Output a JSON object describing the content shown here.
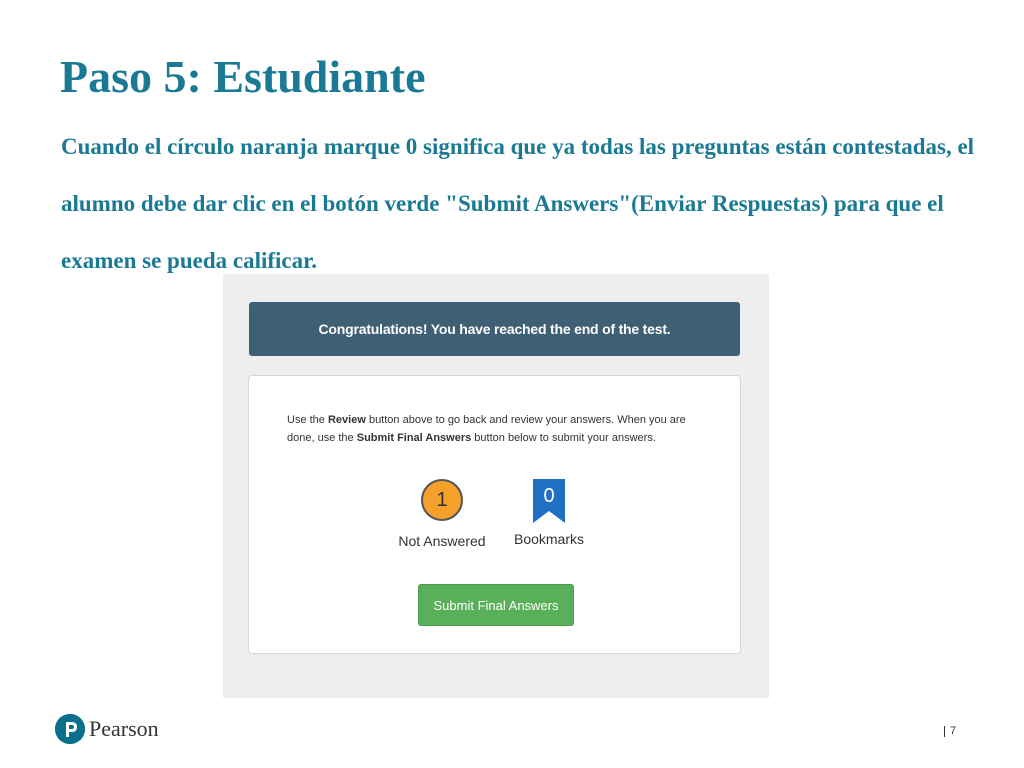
{
  "slide": {
    "title": "Paso 5: Estudiante",
    "body": "Cuando el círculo naranja marque 0 significa que ya todas las preguntas están contestadas, el alumno debe dar clic en el botón verde \"Submit Answers\"(Enviar Respuestas) para que el examen se pueda calificar.",
    "page_number": "7"
  },
  "brand": {
    "name": "Pearson",
    "color": "#0a6f8a"
  },
  "test_screen": {
    "banner": "Congratulations! You have reached the end of the test.",
    "instructions": {
      "part1": "Use the ",
      "review": "Review",
      "part2": " button above to go back and review your answers. When you are done, use the ",
      "submit_final": "Submit Final Answers",
      "part3": " button below to submit your answers."
    },
    "not_answered": {
      "count": "1",
      "label": "Not Answered",
      "color": "#f6a02c"
    },
    "bookmarks": {
      "count": "0",
      "label": "Bookmarks",
      "color": "#1f6fc4"
    },
    "submit_button": "Submit Final Answers",
    "banner_color": "#3e5f74",
    "button_color": "#5aaf5a"
  }
}
